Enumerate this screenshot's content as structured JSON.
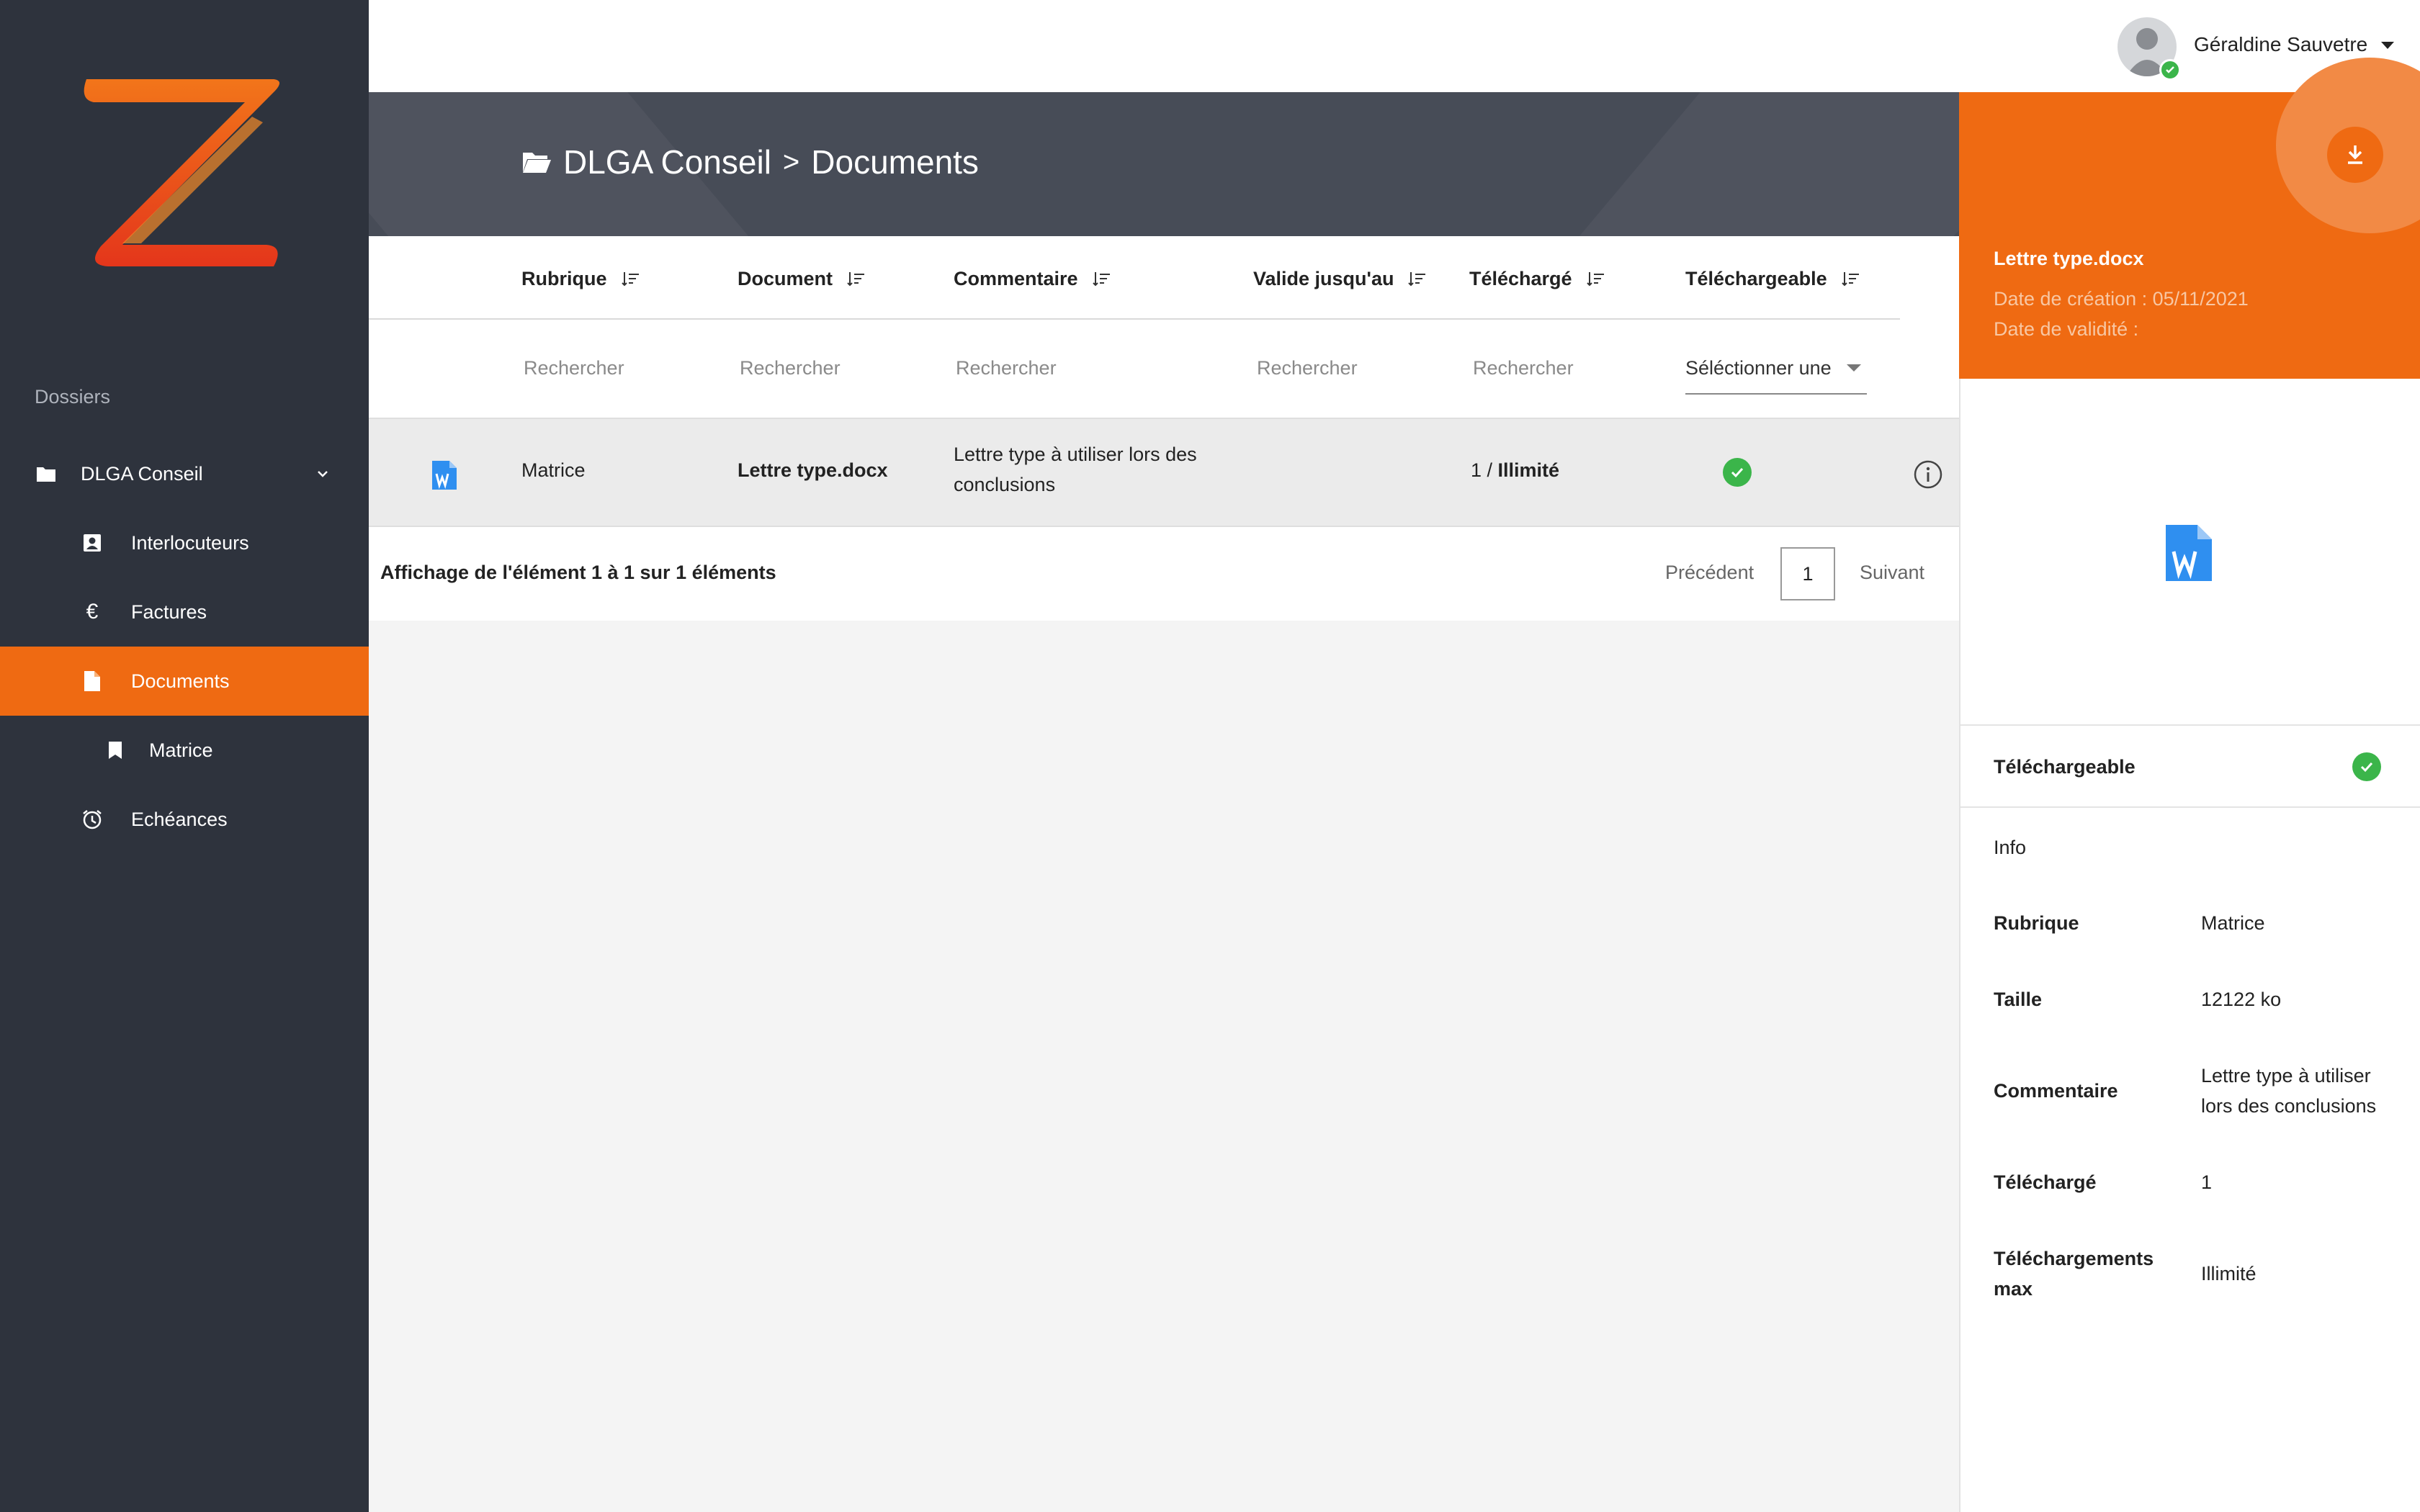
{
  "sidebar": {
    "section_label": "Dossiers",
    "items": [
      {
        "label": "DLGA Conseil"
      },
      {
        "label": "Interlocuteurs"
      },
      {
        "label": "Factures"
      },
      {
        "label": "Documents"
      },
      {
        "label": "Matrice"
      },
      {
        "label": "Echéances"
      }
    ],
    "active_color": "#ef6a12"
  },
  "user": {
    "name": "Géraldine Sauvetre",
    "status": "online"
  },
  "header": {
    "folder": "DLGA Conseil",
    "separator": ">",
    "page": "Documents"
  },
  "table": {
    "columns": [
      "Rubrique",
      "Document",
      "Commentaire",
      "Valide jusqu'au",
      "Téléchargé",
      "Téléchargeable"
    ],
    "filters": {
      "placeholder": "Rechercher",
      "select_placeholder": "Séléctionner une"
    },
    "rows": [
      {
        "icon": "word-file-icon",
        "rubrique": "Matrice",
        "document": "Lettre type.docx",
        "commentaire_line1": "Lettre type à utiliser lors des",
        "commentaire_line2": "conclusions",
        "valide": "",
        "telecharge_count": "1 / ",
        "telecharge_max": "Illimité",
        "telechargeable": true
      }
    ],
    "footer": {
      "info": "Affichage de l'élément 1 à 1 sur 1 éléments",
      "prev": "Précédent",
      "page": "1",
      "next": "Suivant"
    }
  },
  "panel": {
    "file_name": "Lettre type.docx",
    "created": "Date de création : 05/11/2021",
    "validity": "Date de validité :",
    "downloadable_label": "Téléchargeable",
    "info_label": "Info",
    "details": {
      "rubrique_label": "Rubrique",
      "rubrique_value": "Matrice",
      "taille_label": "Taille",
      "taille_value": "12122 ko",
      "commentaire_label": "Commentaire",
      "commentaire_value_line1": "Lettre type à utiliser",
      "commentaire_value_line2": "lors des conclusions",
      "telecharge_label": "Téléchargé",
      "telecharge_value": "1",
      "max_label_line1": "Téléchargements",
      "max_label_line2": "max",
      "max_value": "Illimité"
    }
  },
  "colors": {
    "accent": "#ef6a12",
    "sidebar": "#2e333d",
    "banner": "#474c57",
    "success": "#3bb54a",
    "word_blue": "#2f8ff0"
  }
}
